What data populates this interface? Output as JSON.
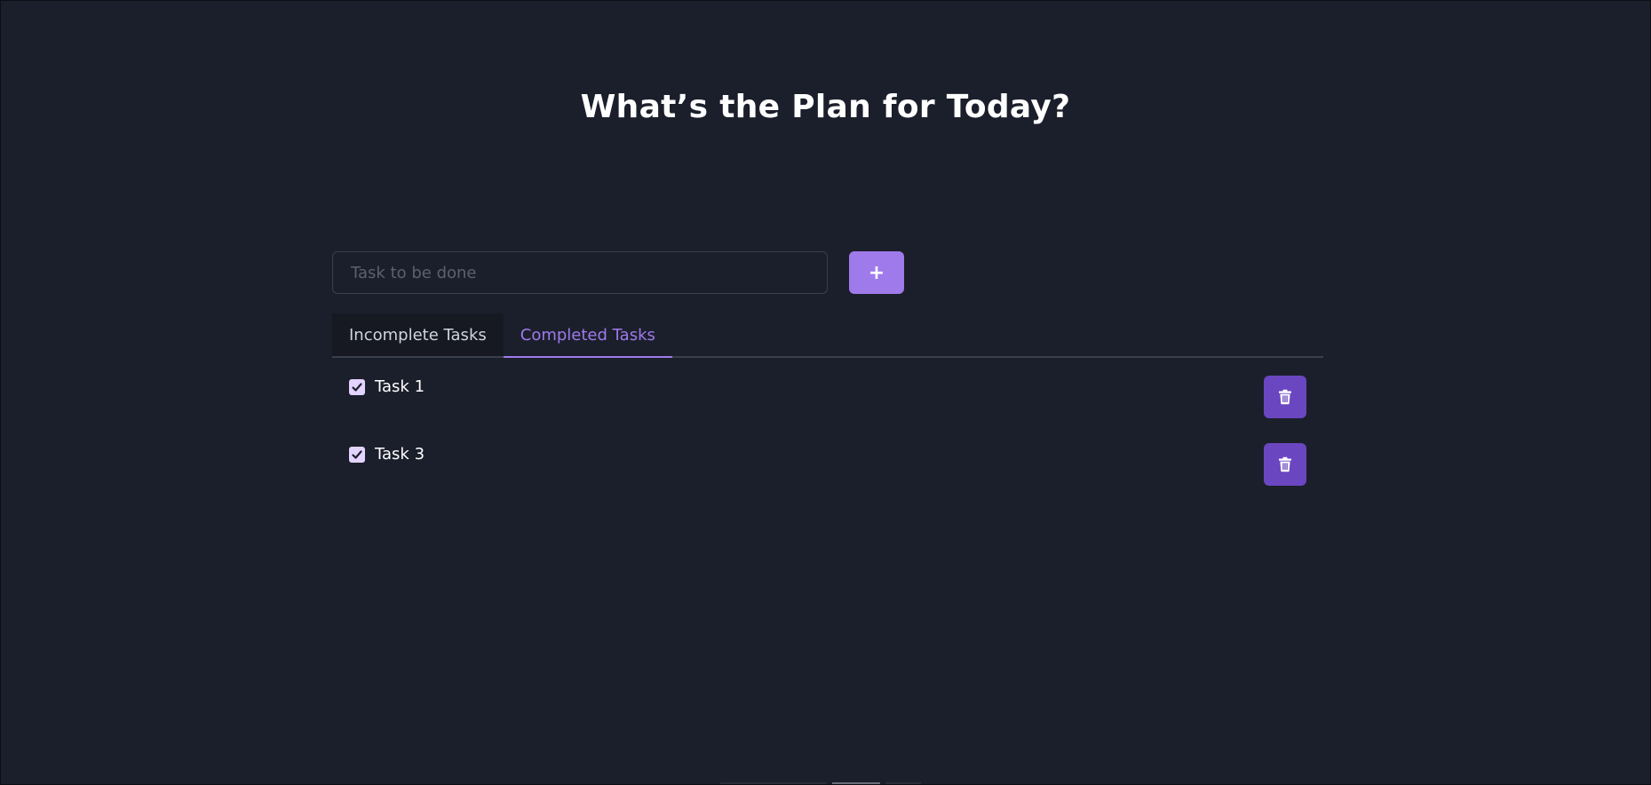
{
  "header": {
    "title": "What’s the Plan for Today?"
  },
  "new_task": {
    "placeholder": "Task to be done",
    "value": "",
    "add_label": "+"
  },
  "tabs": [
    {
      "label": "Incomplete Tasks",
      "active": false
    },
    {
      "label": "Completed Tasks",
      "active": true
    }
  ],
  "tasks": [
    {
      "label": "Task 1",
      "checked": true,
      "delete_icon": "trash-icon"
    },
    {
      "label": "Task 3",
      "checked": true,
      "delete_icon": "trash-icon"
    }
  ],
  "colors": {
    "background": "#1b1f2b",
    "accent": "#9f7aea",
    "delete_button": "#6b46c1",
    "checkbox": "#e3d3ff"
  },
  "icons": {
    "checkbox": "checkmark-icon",
    "delete": "trash-icon"
  }
}
